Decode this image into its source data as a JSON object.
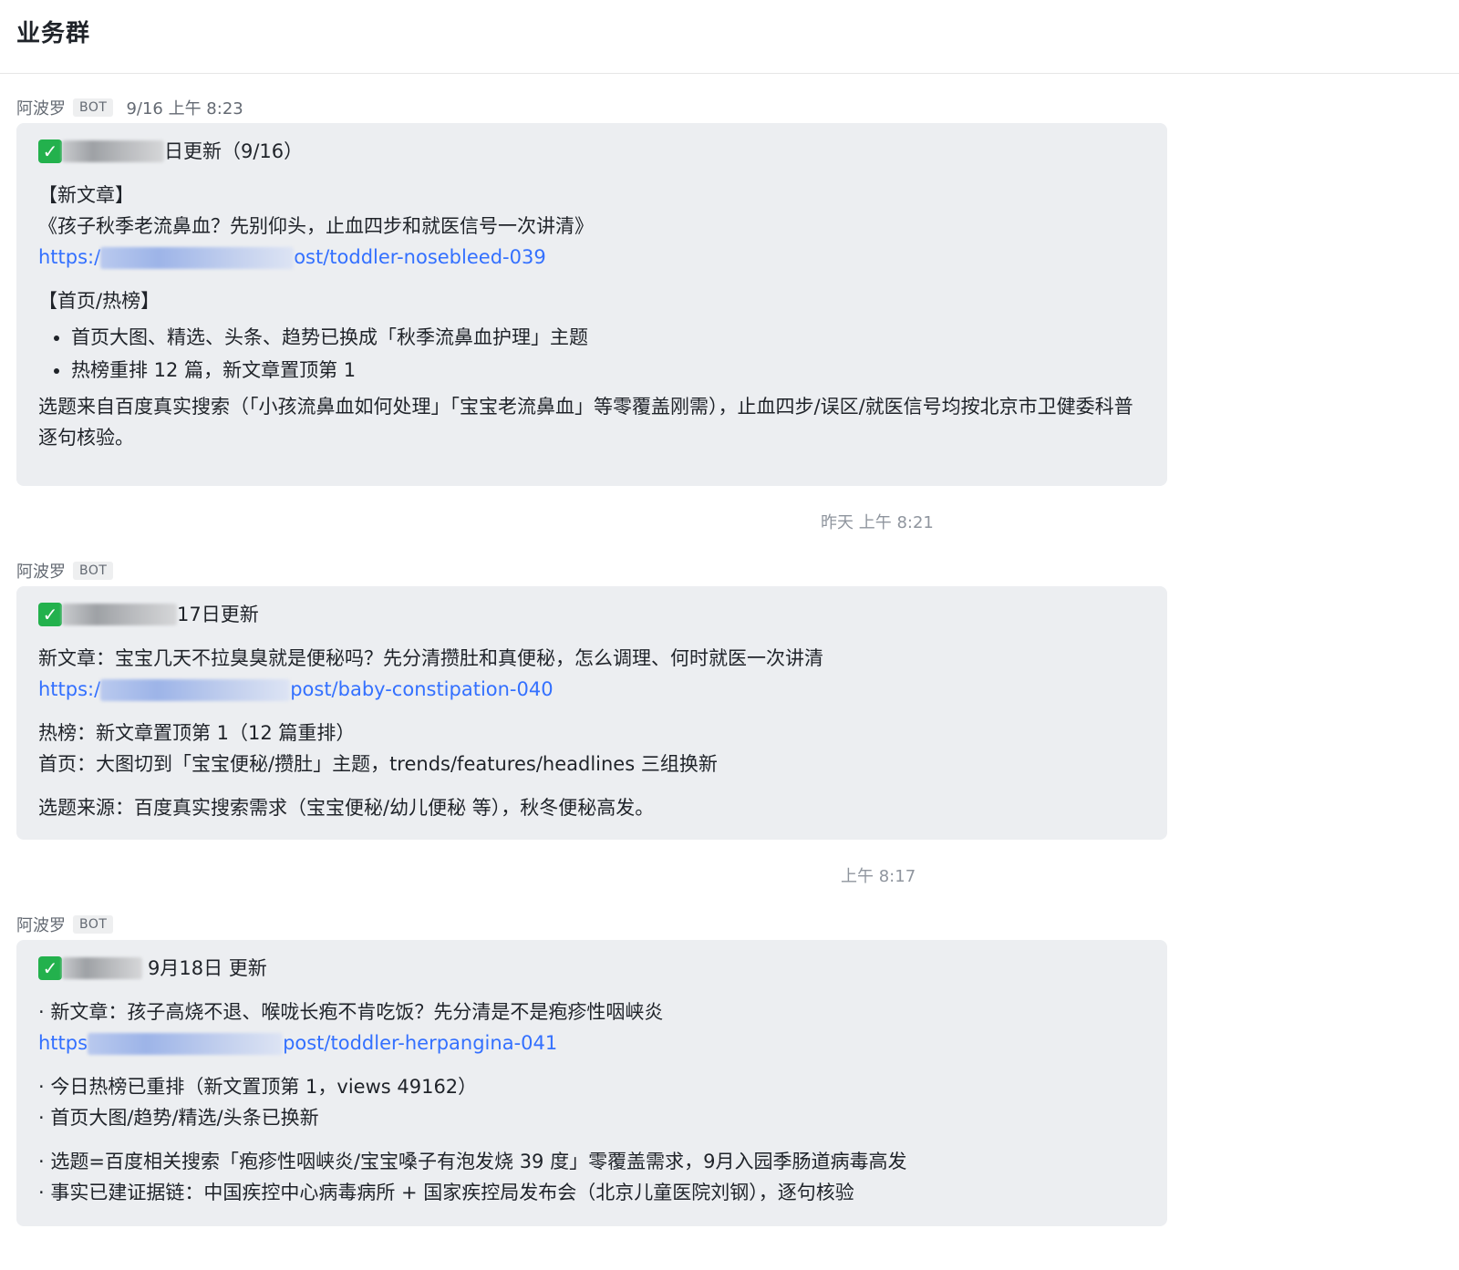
{
  "header": {
    "title": "业务群"
  },
  "messages": [
    {
      "sender": "阿波罗",
      "badge": "BOT",
      "time": "9/16 上午 8:23",
      "headline_suffix": "日更新（9/16）",
      "section1_title": "【新文章】",
      "article_title": "《孩子秋季老流鼻血？先别仰头，止血四步和就医信号一次讲清》",
      "link_prefix": "https:/",
      "link_suffix": "ost/toddler-nosebleed-039",
      "section2_title": "【首页/热榜】",
      "bullets": [
        "首页大图、精选、头条、趋势已换成「秋季流鼻血护理」主题",
        "热榜重排 12 篇，新文章置顶第 1"
      ],
      "footer": "选题来自百度真实搜索（「小孩流鼻血如何处理」「宝宝老流鼻血」等零覆盖刚需），止血四步/误区/就医信号均按北京市卫健委科普逐句核验。"
    },
    {
      "sender": "阿波罗",
      "badge": "BOT",
      "separator_time": "昨天 上午 8:21",
      "headline_suffix": "17日更新",
      "article_line": "新文章：宝宝几天不拉臭臭就是便秘吗？先分清攒肚和真便秘，怎么调理、何时就医一次讲清",
      "link_prefix": "https:/",
      "link_suffix": "post/baby-constipation-040",
      "hot_line": "热榜：新文章置顶第 1（12 篇重排）",
      "home_line": "首页：大图切到「宝宝便秘/攒肚」主题，trends/features/headlines 三组换新",
      "source_line": "选题来源：百度真实搜索需求（宝宝便秘/幼儿便秘 等），秋冬便秘高发。"
    },
    {
      "sender": "阿波罗",
      "badge": "BOT",
      "separator_time": "上午 8:17",
      "headline_suffix": "9月18日 更新",
      "article_line": "· 新文章：孩子高烧不退、喉咙长疱不肯吃饭？先分清是不是疱疹性咽峡炎",
      "link_prefix": "https",
      "link_suffix": "post/toddler-herpangina-041",
      "line_a": "· 今日热榜已重排（新文置顶第 1，views 49162）",
      "line_b": "· 首页大图/趋势/精选/头条已换新",
      "line_c": "· 选题=百度相关搜索「疱疹性咽峡炎/宝宝嗓子有泡发烧 39 度」零覆盖需求，9月入园季肠道病毒高发",
      "line_d": "· 事实已建证据链：中国疾控中心病毒病所 + 国家疾控局发布会（北京儿童医院刘钢），逐句核验"
    }
  ]
}
